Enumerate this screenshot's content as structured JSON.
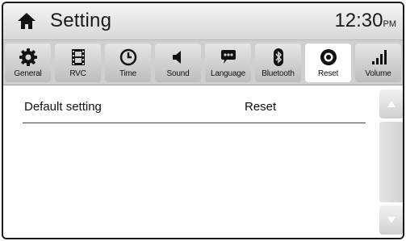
{
  "header": {
    "home_icon": "home-icon",
    "title": "Setting",
    "time": "12:30",
    "ampm": "PM"
  },
  "tabs": [
    {
      "label": "General",
      "icon": "gear-icon",
      "active": false
    },
    {
      "label": "RVC",
      "icon": "film-icon",
      "active": false
    },
    {
      "label": "Time",
      "icon": "clock-icon",
      "active": false
    },
    {
      "label": "Sound",
      "icon": "speaker-icon",
      "active": false
    },
    {
      "label": "Language",
      "icon": "speech-bubble-icon",
      "active": false
    },
    {
      "label": "Bluetooth",
      "icon": "bluetooth-icon",
      "active": false
    },
    {
      "label": "Reset",
      "icon": "reset-icon",
      "active": true
    },
    {
      "label": "Volume",
      "icon": "volume-bars-icon",
      "active": false
    }
  ],
  "content": {
    "row_label": "Default setting",
    "row_value": "Reset"
  },
  "scrollbar": {
    "up_icon": "triangle-up-icon",
    "down_icon": "triangle-down-icon"
  }
}
